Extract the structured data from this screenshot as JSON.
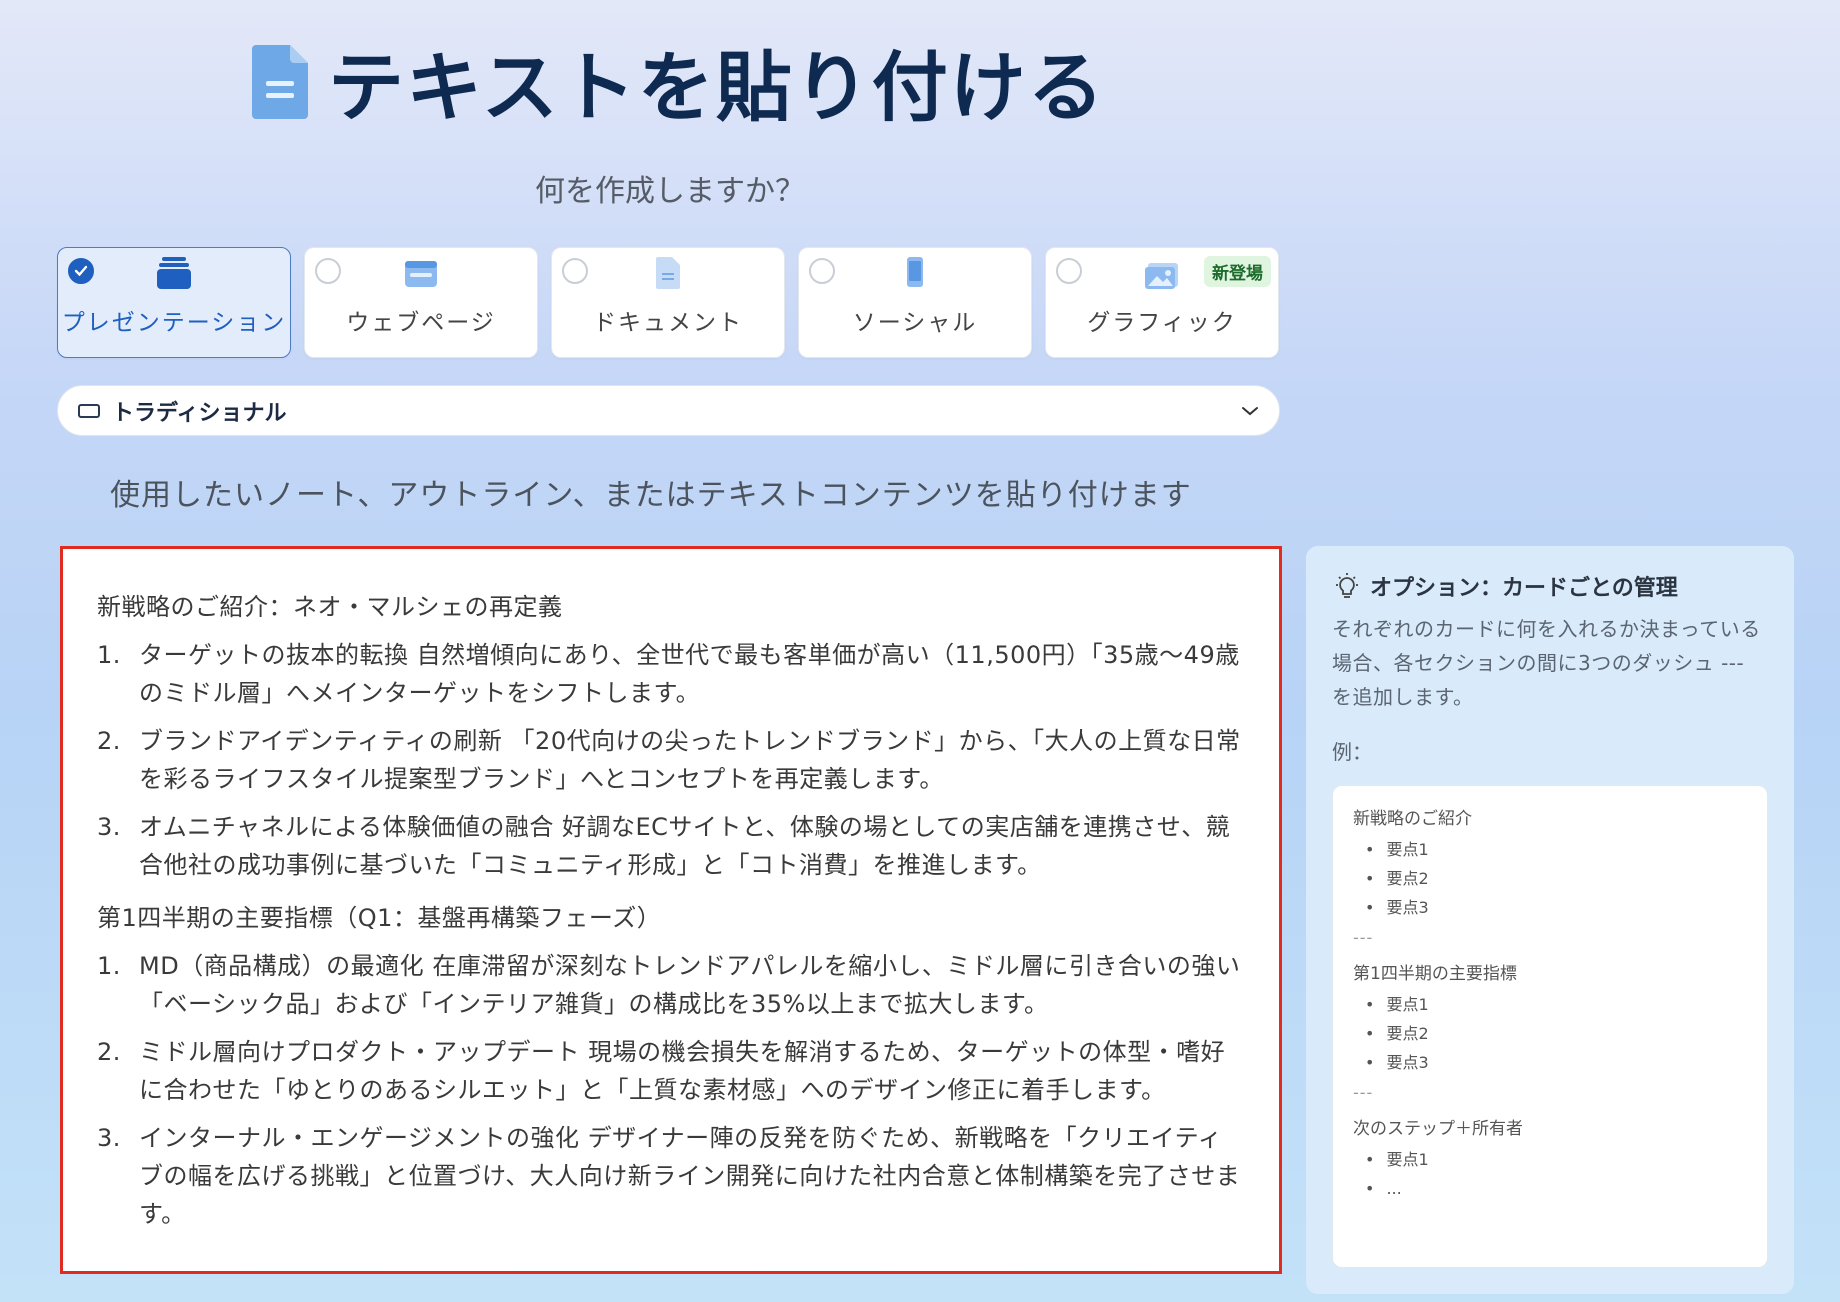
{
  "header": {
    "title": "テキストを貼り付ける"
  },
  "subtitle": "何を作成しますか？",
  "types": [
    {
      "label": "プレゼンテーション",
      "icon": "stack-icon",
      "selected": true
    },
    {
      "label": "ウェブページ",
      "icon": "browser-icon",
      "selected": false
    },
    {
      "label": "ドキュメント",
      "icon": "document-icon",
      "selected": false
    },
    {
      "label": "ソーシャル",
      "icon": "phone-icon",
      "selected": false
    },
    {
      "label": "グラフィック",
      "icon": "image-icon",
      "selected": false,
      "badge": "新登場"
    }
  ],
  "dropdown": {
    "label": "トラディショナル"
  },
  "instruction": "使用したいノート、アウトライン、またはテキストコンテンツを貼り付けます",
  "editor": {
    "sections": [
      {
        "title": "新戦略のご紹介：ネオ・マルシェの再定義",
        "items": [
          {
            "num": "1.",
            "text": "ターゲットの抜本的転換 自然増傾向にあり、全世代で最も客単価が高い（11,500円）「35歳〜49歳のミドル層」へメインターゲットをシフトします。"
          },
          {
            "num": "2.",
            "text": "ブランドアイデンティティの刷新 「20代向けの尖ったトレンドブランド」から、「大人の上質な日常を彩るライフスタイル提案型ブランド」へとコンセプトを再定義します。"
          },
          {
            "num": "3.",
            "text": "オムニチャネルによる体験価値の融合 好調なECサイトと、体験の場としての実店舗を連携させ、競合他社の成功事例に基づいた「コミュニティ形成」と「コト消費」を推進します。"
          }
        ]
      },
      {
        "title": "第1四半期の主要指標（Q1：基盤再構築フェーズ）",
        "items": [
          {
            "num": "1.",
            "text": "MD（商品構成）の最適化 在庫滞留が深刻なトレンドアパレルを縮小し、ミドル層に引き合いの強い「ベーシック品」および「インテリア雑貨」の構成比を35%以上まで拡大します。"
          },
          {
            "num": "2.",
            "text": "ミドル層向けプロダクト・アップデート 現場の機会損失を解消するため、ターゲットの体型・嗜好に合わせた「ゆとりのあるシルエット」と「上質な素材感」へのデザイン修正に着手します。"
          },
          {
            "num": "3.",
            "text": "インターナル・エンゲージメントの強化 デザイナー陣の反発を防ぐため、新戦略を「クリエイティブの幅を広げる挑戦」と位置づけ、大人向け新ライン開発に向けた社内合意と体制構築を完了させます。"
          }
        ]
      }
    ]
  },
  "side": {
    "title": "オプション：カードごとの管理",
    "desc": "それぞれのカードに何を入れるか決まっている場合、各セクションの間に3つのダッシュ --- を追加します。",
    "example_label": "例：",
    "example": {
      "blocks": [
        {
          "title": "新戦略のご紹介",
          "items": [
            "要点1",
            "要点2",
            "要点3"
          ]
        },
        {
          "title": "第1四半期の主要指標",
          "items": [
            "要点1",
            "要点2",
            "要点3"
          ]
        },
        {
          "title": "次のステップ＋所有者",
          "items": [
            "要点1",
            "..."
          ]
        }
      ],
      "separator": "---"
    }
  },
  "colors": {
    "accent": "#1f5fbf",
    "title": "#0e2a50",
    "highlight_border": "#e02b20"
  }
}
